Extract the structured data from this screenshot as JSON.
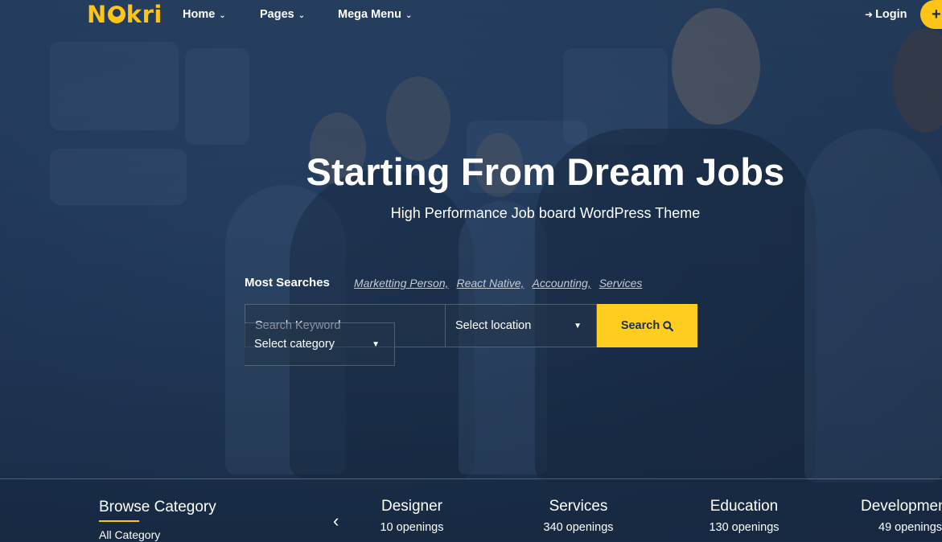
{
  "brand": {
    "logo_text": "Nokri",
    "accent": "#ffc516"
  },
  "nav": {
    "items": [
      {
        "label": "Home"
      },
      {
        "label": "Pages"
      },
      {
        "label": "Mega Menu"
      }
    ],
    "login_label": "Login",
    "plus_label": "+"
  },
  "hero": {
    "title": "Starting From Dream Jobs",
    "subtitle": "High Performance Job board WordPress Theme"
  },
  "most_searches": {
    "label": "Most Searches",
    "tags": [
      "Marketting Person,",
      "React Native,",
      "Accounting,",
      "Services"
    ]
  },
  "search": {
    "keyword_placeholder": "Search Keyword",
    "category_value": "Select category",
    "location_value": "Select location",
    "button_label": "Search"
  },
  "categories": {
    "heading": "Browse Category",
    "all_label": "All Category",
    "items": [
      {
        "name": "Designer",
        "openings": "10 openings"
      },
      {
        "name": "Services",
        "openings": "340 openings"
      },
      {
        "name": "Education",
        "openings": "130 openings"
      },
      {
        "name": "Development",
        "openings": "49 openings"
      }
    ]
  }
}
